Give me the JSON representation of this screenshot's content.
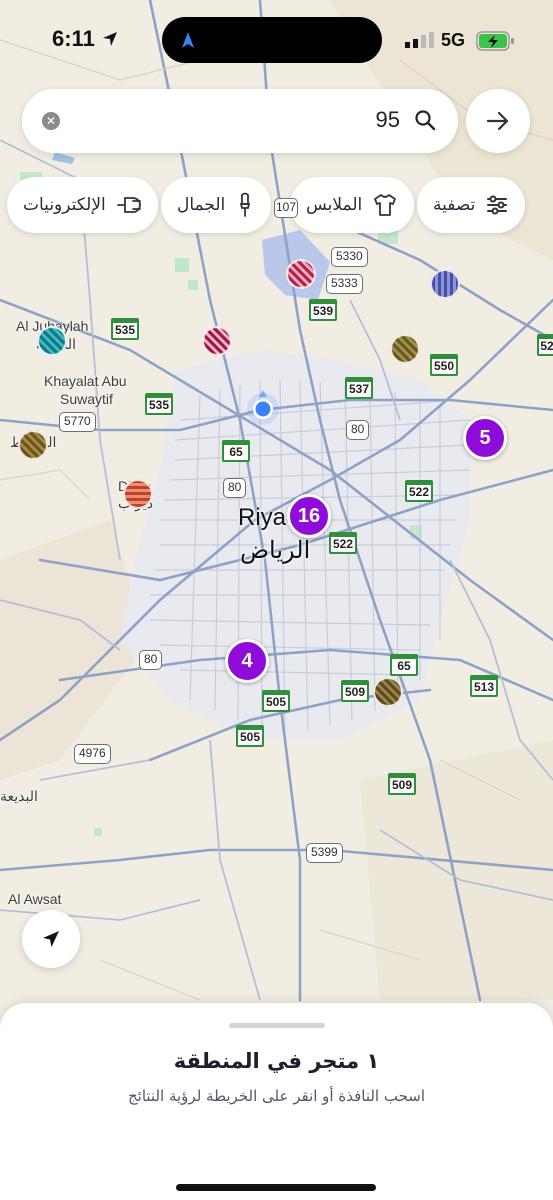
{
  "status_bar": {
    "time": "6:11",
    "network": "5G"
  },
  "search": {
    "value": "95"
  },
  "filters": [
    {
      "label": "تصفية",
      "icon": "sliders-icon"
    },
    {
      "label": "الملابس",
      "icon": "shirt-icon"
    },
    {
      "label": "الجمال",
      "icon": "lipstick-icon"
    },
    {
      "label": "الإلكترونيات",
      "icon": "plug-icon"
    }
  ],
  "map": {
    "places": [
      "Al Juhaylah",
      "الجهيلة",
      "Khayalat Abu",
      "Suwaytif",
      "الغطغط",
      "Dirab",
      "ديراب",
      "Riya",
      "الرياض",
      "البديعة",
      "Al Awsat"
    ],
    "highways": [
      "5330",
      "5333",
      "539",
      "535",
      "535",
      "537",
      "550",
      "5770",
      "80",
      "80",
      "80",
      "65",
      "65",
      "522",
      "522",
      "505",
      "505",
      "509",
      "509",
      "513",
      "4976",
      "5399",
      "52",
      "107"
    ],
    "clusters": [
      "16",
      "5",
      "4"
    ]
  },
  "sheet": {
    "title": "١ متجر في المنطقة",
    "subtitle": "اسحب النافذة أو انقر على الخريطة لرؤية النتائج"
  }
}
